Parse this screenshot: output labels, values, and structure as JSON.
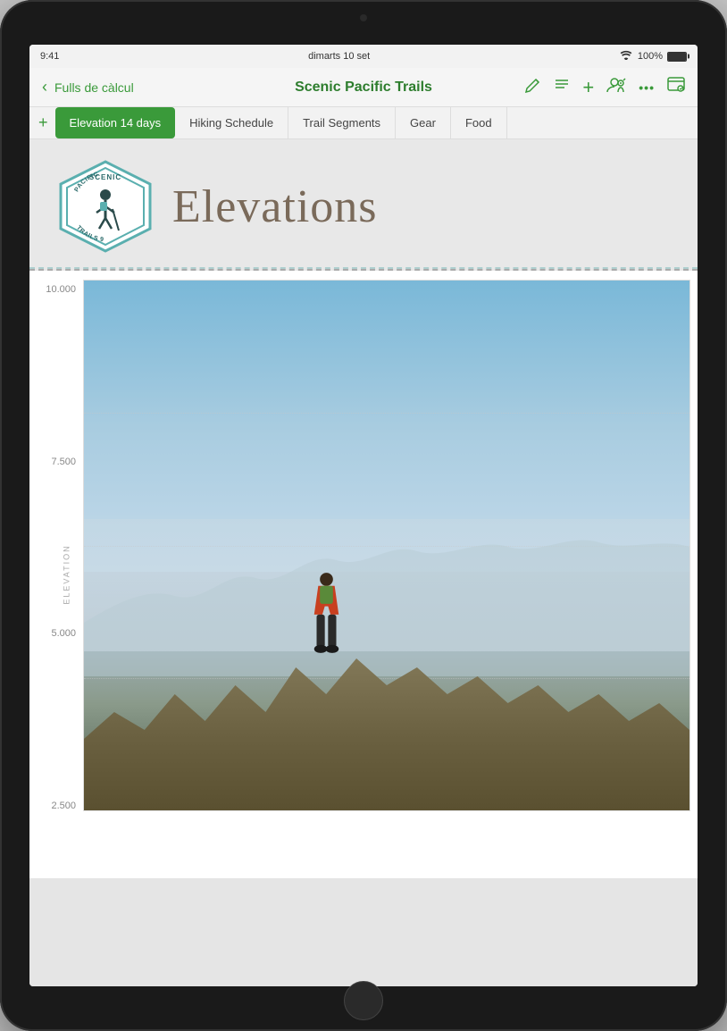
{
  "status_bar": {
    "time": "9:41",
    "date": "dimarts 10 set",
    "wifi": "📶",
    "battery_percent": "100%"
  },
  "toolbar": {
    "back_label": "Fulls de càlcul",
    "title": "Scenic Pacific Trails",
    "icons": {
      "pencil": "✏",
      "list": "≡",
      "plus": "+",
      "collab": "👤",
      "more": "•••",
      "view": "📋"
    }
  },
  "tabs": {
    "add_button": "+",
    "items": [
      {
        "id": "tab-elevation",
        "label": "Elevation 14 days",
        "active": true
      },
      {
        "id": "tab-hiking",
        "label": "Hiking Schedule",
        "active": false
      },
      {
        "id": "tab-trail",
        "label": "Trail Segments",
        "active": false
      },
      {
        "id": "tab-gear",
        "label": "Gear",
        "active": false
      },
      {
        "id": "tab-food",
        "label": "Food",
        "active": false
      }
    ]
  },
  "sheet": {
    "title": "Elevations",
    "logo_text_top": "SCENIC",
    "logo_text_trails": "TRAILS",
    "logo_text_pacific": "PACIFIC",
    "chart": {
      "y_axis_title": "ELEVATION",
      "y_labels": [
        "10.000",
        "7.500",
        "5.000",
        "2.500"
      ]
    }
  }
}
